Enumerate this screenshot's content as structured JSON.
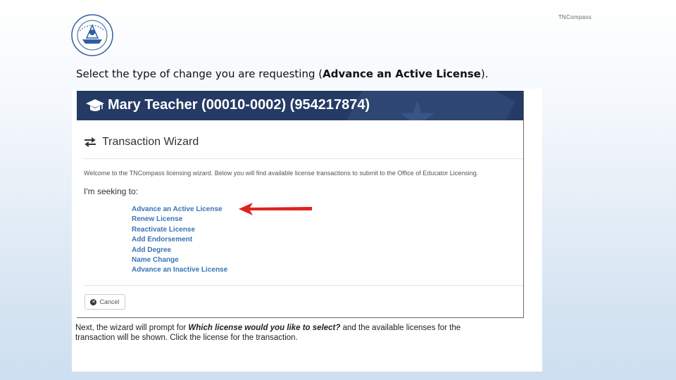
{
  "brand": "TNCompass",
  "instruction": {
    "prefix": "Select the type of change you are requesting (",
    "emphasis": "Advance an Active License",
    "suffix": ")."
  },
  "banner": {
    "title": "Mary Teacher (00010-0002) (954217874)",
    "icon": "graduation-cap-icon",
    "bg_color": "#253a64"
  },
  "wizard": {
    "title": "Transaction Wizard",
    "icon": "swap-arrows-icon",
    "welcome": "Welcome to the TNCompass licensing wizard. Below you will find available license transactions to submit to the Office of Educator Licensing.",
    "seeking": "I'm seeking to:",
    "options": [
      "Advance an Active License",
      "Renew License",
      "Reactivate License",
      "Add Endorsement",
      "Add Degree",
      "Name Change",
      "Advance an Inactive License"
    ],
    "link_color": "#3875b4",
    "cancel_label": "Cancel"
  },
  "caption": {
    "part1": "Next, the wizard will prompt for ",
    "emphasis": "Which license would you like to select?",
    "part2": " and the available licenses for the transaction will be shown. Click the license for the transaction."
  },
  "arrow_color": "#e0231e"
}
